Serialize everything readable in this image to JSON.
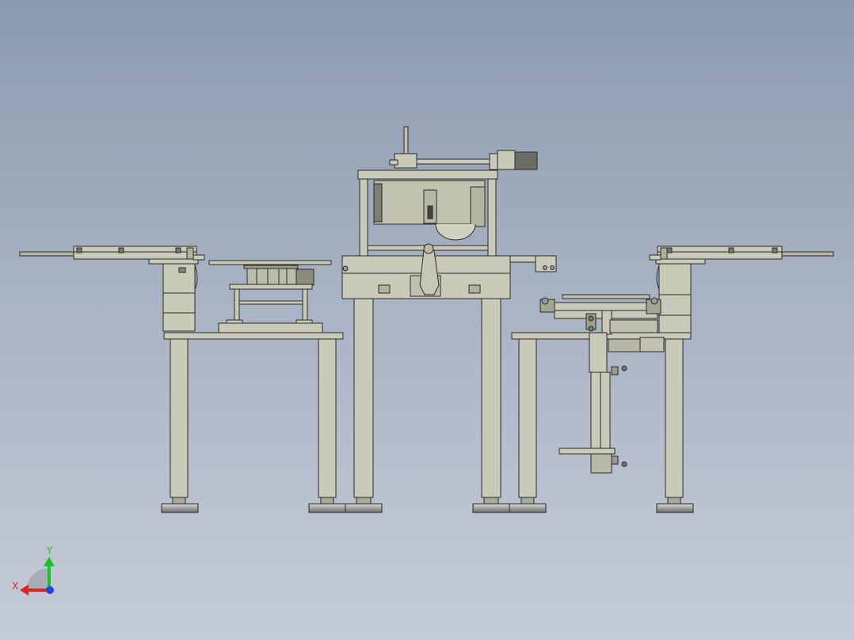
{
  "triad": {
    "x_label": "X",
    "y_label": "Y",
    "x_color": "#e0231c",
    "y_color": "#1fbf2a",
    "z_color": "#2742d6"
  },
  "colors": {
    "metal": "#c9cbb8",
    "metal_dark": "#a9ab98",
    "line": "#2a2a2a",
    "foot": "#8e8e8e"
  }
}
